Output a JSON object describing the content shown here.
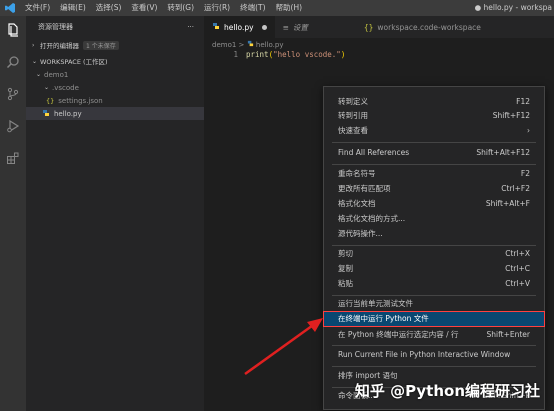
{
  "titlebar": {
    "menu": [
      "文件(F)",
      "编辑(E)",
      "选择(S)",
      "查看(V)",
      "转到(G)",
      "运行(R)",
      "终端(T)",
      "帮助(H)"
    ],
    "window_title": "● hello.py - workspa"
  },
  "sidebar": {
    "header": "资源管理器",
    "more": "···",
    "open_editors": "打开的编辑器",
    "open_editors_badge": "1 个未保存",
    "workspace": "WORKSPACE (工作区)",
    "folder": "demo1",
    "subfolder": ".vscode",
    "settings_file": "settings.json",
    "file": "hello.py"
  },
  "tabs": [
    {
      "label": "hello.py",
      "dirty": true,
      "active": true
    },
    {
      "label": "设置",
      "dirty": false,
      "active": false
    },
    {
      "label": "workspace.code-workspace",
      "dirty": false,
      "active": false
    }
  ],
  "breadcrumb": {
    "folder": "demo1",
    "sep": ">",
    "file": "hello.py"
  },
  "code": {
    "line_number": "1",
    "fn": "print",
    "open": "(",
    "str": "\"hello vscode.\"",
    "close": ")"
  },
  "context_menu": {
    "items": [
      {
        "label": "转到定义",
        "key": "F12"
      },
      {
        "label": "转到引用",
        "key": "Shift+F12"
      },
      {
        "label": "快速查看",
        "key": "›"
      },
      {
        "label": "Find All References",
        "key": "Shift+Alt+F12"
      },
      {
        "label": "重命名符号",
        "key": "F2"
      },
      {
        "label": "更改所有匹配项",
        "key": "Ctrl+F2"
      },
      {
        "label": "格式化文档",
        "key": "Shift+Alt+F"
      },
      {
        "label": "格式化文档的方式...",
        "key": ""
      },
      {
        "label": "源代码操作...",
        "key": ""
      },
      {
        "label": "剪切",
        "key": "Ctrl+X"
      },
      {
        "label": "复制",
        "key": "Ctrl+C"
      },
      {
        "label": "粘贴",
        "key": "Ctrl+V"
      },
      {
        "label": "运行当前单元测试文件",
        "key": ""
      },
      {
        "label": "在终端中运行 Python 文件",
        "key": ""
      },
      {
        "label": "在 Python 终端中运行选定内容 / 行",
        "key": "Shift+Enter"
      },
      {
        "label": "Run Current File in Python Interactive Window",
        "key": ""
      },
      {
        "label": "排序 import 语句",
        "key": ""
      },
      {
        "label": "命令面板...",
        "key": "Ctrl+Shift+P"
      }
    ]
  },
  "watermark": "知乎 @Python编程研习社",
  "colors": {
    "accent": "#094771",
    "highlight_border": "#ff4040",
    "arrow": "#e02020"
  }
}
